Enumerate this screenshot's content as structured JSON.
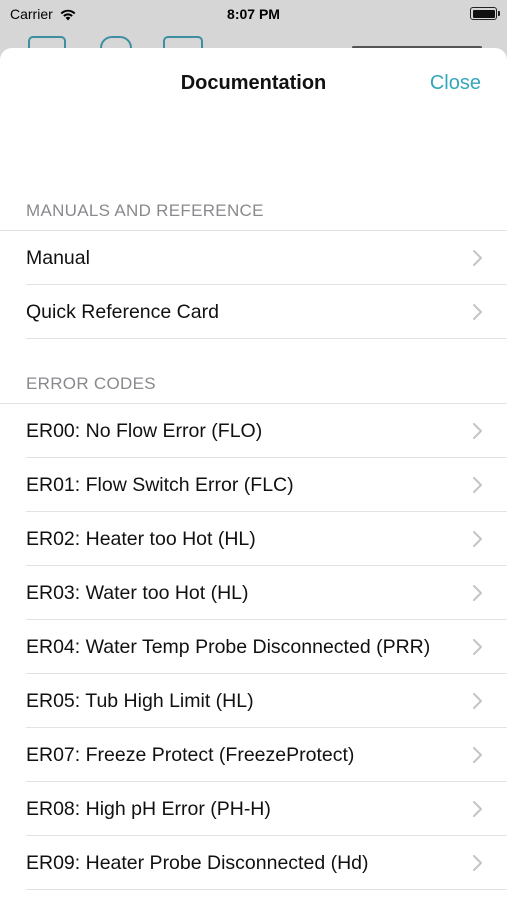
{
  "status_bar": {
    "carrier": "Carrier",
    "time": "8:07 PM"
  },
  "nav": {
    "title": "Documentation",
    "close_label": "Close"
  },
  "sections": [
    {
      "header": "MANUALS AND REFERENCE",
      "items": [
        "Manual",
        "Quick Reference Card"
      ]
    },
    {
      "header": "ERROR CODES",
      "items": [
        "ER00: No Flow Error (FLO)",
        "ER01: Flow Switch Error (FLC)",
        "ER02: Heater too Hot (HL)",
        "ER03: Water too Hot (HL)",
        "ER04: Water Temp Probe Disconnected (PRR)",
        "ER05: Tub High Limit (HL)",
        "ER07: Freeze Protect (FreezeProtect)",
        "ER08: High pH Error (PH-H)",
        "ER09: Heater Probe Disconnected (Hd)"
      ]
    }
  ],
  "colors": {
    "accent": "#34a7bd",
    "section_header": "#8a8a8e",
    "separator": "#e3e3e6",
    "chevron": "#c4c4c7"
  },
  "icons": {
    "wifi": "wifi-icon",
    "battery": "battery-icon",
    "chevron": "chevron-right-icon"
  }
}
